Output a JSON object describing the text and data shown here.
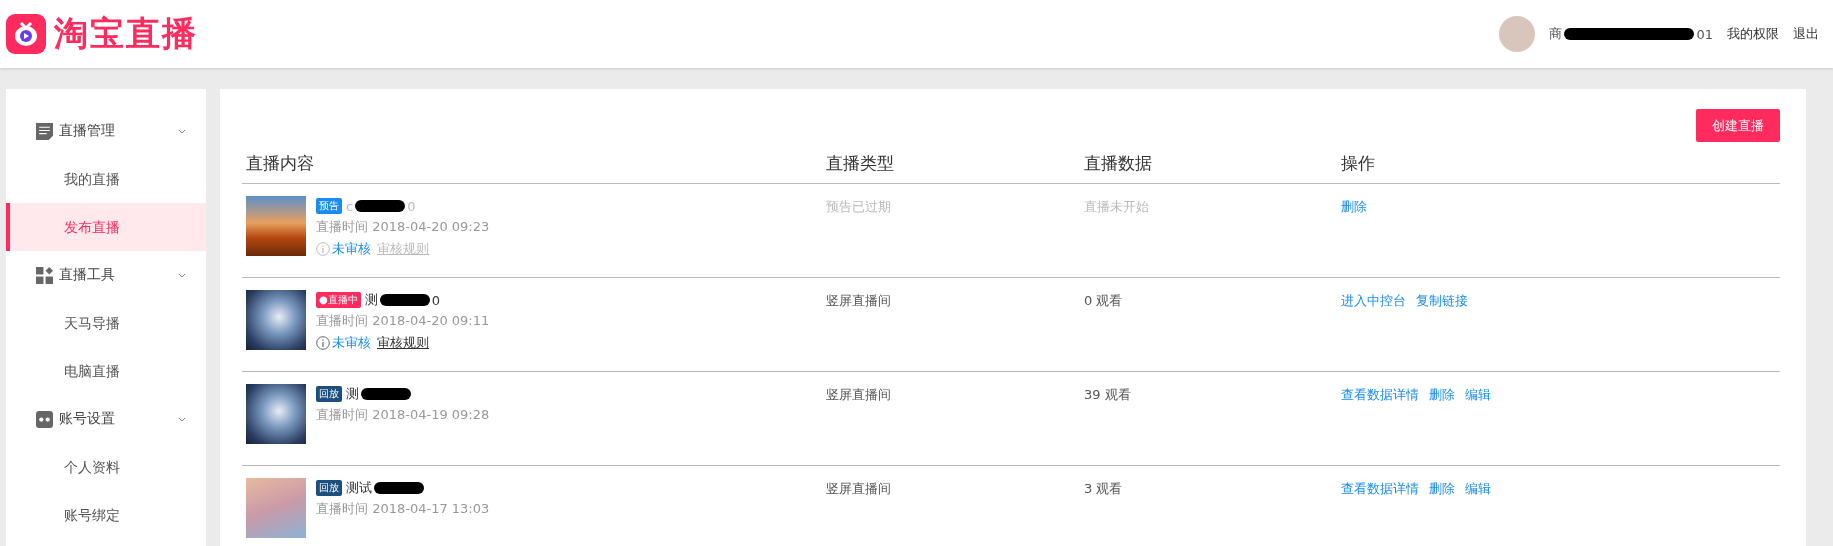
{
  "header": {
    "logo_text": "淘宝直播",
    "user": {
      "name_parts": [
        "商",
        "01"
      ]
    },
    "links": [
      "我的权限",
      "退出"
    ]
  },
  "sidebar": {
    "groups": [
      {
        "label": "直播管理",
        "expanded": true,
        "items": [
          {
            "label": "我的直播",
            "selected": false
          },
          {
            "label": "发布直播",
            "selected": true
          }
        ]
      },
      {
        "label": "直播工具",
        "expanded": true,
        "items": [
          {
            "label": "天马导播",
            "selected": false
          },
          {
            "label": "电脑直播",
            "selected": false
          }
        ]
      },
      {
        "label": "账号设置",
        "expanded": true,
        "items": [
          {
            "label": "个人资料",
            "selected": false
          },
          {
            "label": "账号绑定",
            "selected": false
          }
        ]
      }
    ]
  },
  "create_button": "创建直播",
  "table": {
    "columns": [
      "直播内容",
      "直播类型",
      "直播数据",
      "操作"
    ],
    "rows": [
      {
        "badge": {
          "kind": "preview",
          "label": "预告"
        },
        "title_parts": [
          "c",
          "0"
        ],
        "time": "直播时间 2018-04-20 09:23",
        "expired": true,
        "review": {
          "status": "未审核",
          "rule": "审核规则"
        },
        "type": "预告已过期",
        "data": "直播未开始",
        "actions": [
          "删除"
        ]
      },
      {
        "badge": {
          "kind": "live",
          "label": "●直播中"
        },
        "title_parts": [
          "测",
          "0"
        ],
        "time": "直播时间 2018-04-20 09:11",
        "expired": false,
        "review": {
          "status": "未审核",
          "rule": "审核规则"
        },
        "type": "竖屏直播间",
        "data": "0 观看",
        "actions": [
          "进入中控台",
          "复制链接"
        ]
      },
      {
        "badge": {
          "kind": "replay",
          "label": "回放"
        },
        "title_parts": [
          "测"
        ],
        "time": "直播时间 2018-04-19 09:28",
        "expired": false,
        "type": "竖屏直播间",
        "data": "39 观看",
        "actions": [
          "查看数据详情",
          "删除",
          "编辑"
        ]
      },
      {
        "badge": {
          "kind": "replay",
          "label": "回放"
        },
        "title_parts": [
          "测试"
        ],
        "time": "直播时间 2018-04-17 13:03",
        "expired": false,
        "type": "竖屏直播间",
        "data": "3 观看",
        "actions": [
          "查看数据详情",
          "删除",
          "编辑"
        ]
      }
    ]
  }
}
